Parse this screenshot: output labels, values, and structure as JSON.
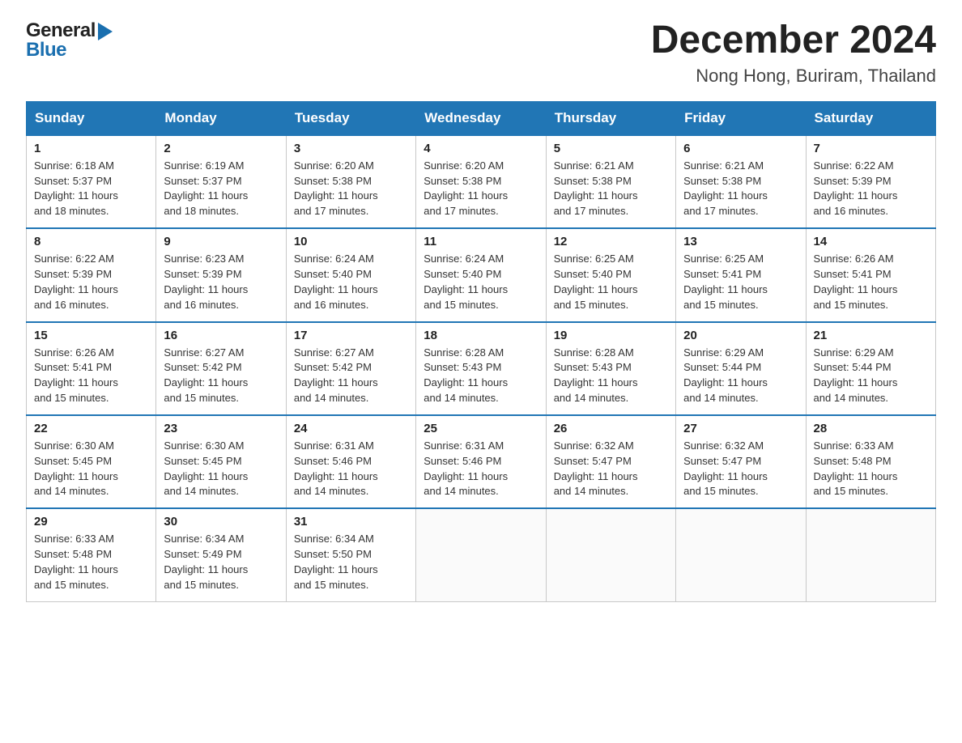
{
  "header": {
    "logo_general": "General",
    "logo_blue": "Blue",
    "month_title": "December 2024",
    "location": "Nong Hong, Buriram, Thailand"
  },
  "weekdays": [
    "Sunday",
    "Monday",
    "Tuesday",
    "Wednesday",
    "Thursday",
    "Friday",
    "Saturday"
  ],
  "weeks": [
    [
      {
        "day": "1",
        "info": "Sunrise: 6:18 AM\nSunset: 5:37 PM\nDaylight: 11 hours\nand 18 minutes."
      },
      {
        "day": "2",
        "info": "Sunrise: 6:19 AM\nSunset: 5:37 PM\nDaylight: 11 hours\nand 18 minutes."
      },
      {
        "day": "3",
        "info": "Sunrise: 6:20 AM\nSunset: 5:38 PM\nDaylight: 11 hours\nand 17 minutes."
      },
      {
        "day": "4",
        "info": "Sunrise: 6:20 AM\nSunset: 5:38 PM\nDaylight: 11 hours\nand 17 minutes."
      },
      {
        "day": "5",
        "info": "Sunrise: 6:21 AM\nSunset: 5:38 PM\nDaylight: 11 hours\nand 17 minutes."
      },
      {
        "day": "6",
        "info": "Sunrise: 6:21 AM\nSunset: 5:38 PM\nDaylight: 11 hours\nand 17 minutes."
      },
      {
        "day": "7",
        "info": "Sunrise: 6:22 AM\nSunset: 5:39 PM\nDaylight: 11 hours\nand 16 minutes."
      }
    ],
    [
      {
        "day": "8",
        "info": "Sunrise: 6:22 AM\nSunset: 5:39 PM\nDaylight: 11 hours\nand 16 minutes."
      },
      {
        "day": "9",
        "info": "Sunrise: 6:23 AM\nSunset: 5:39 PM\nDaylight: 11 hours\nand 16 minutes."
      },
      {
        "day": "10",
        "info": "Sunrise: 6:24 AM\nSunset: 5:40 PM\nDaylight: 11 hours\nand 16 minutes."
      },
      {
        "day": "11",
        "info": "Sunrise: 6:24 AM\nSunset: 5:40 PM\nDaylight: 11 hours\nand 15 minutes."
      },
      {
        "day": "12",
        "info": "Sunrise: 6:25 AM\nSunset: 5:40 PM\nDaylight: 11 hours\nand 15 minutes."
      },
      {
        "day": "13",
        "info": "Sunrise: 6:25 AM\nSunset: 5:41 PM\nDaylight: 11 hours\nand 15 minutes."
      },
      {
        "day": "14",
        "info": "Sunrise: 6:26 AM\nSunset: 5:41 PM\nDaylight: 11 hours\nand 15 minutes."
      }
    ],
    [
      {
        "day": "15",
        "info": "Sunrise: 6:26 AM\nSunset: 5:41 PM\nDaylight: 11 hours\nand 15 minutes."
      },
      {
        "day": "16",
        "info": "Sunrise: 6:27 AM\nSunset: 5:42 PM\nDaylight: 11 hours\nand 15 minutes."
      },
      {
        "day": "17",
        "info": "Sunrise: 6:27 AM\nSunset: 5:42 PM\nDaylight: 11 hours\nand 14 minutes."
      },
      {
        "day": "18",
        "info": "Sunrise: 6:28 AM\nSunset: 5:43 PM\nDaylight: 11 hours\nand 14 minutes."
      },
      {
        "day": "19",
        "info": "Sunrise: 6:28 AM\nSunset: 5:43 PM\nDaylight: 11 hours\nand 14 minutes."
      },
      {
        "day": "20",
        "info": "Sunrise: 6:29 AM\nSunset: 5:44 PM\nDaylight: 11 hours\nand 14 minutes."
      },
      {
        "day": "21",
        "info": "Sunrise: 6:29 AM\nSunset: 5:44 PM\nDaylight: 11 hours\nand 14 minutes."
      }
    ],
    [
      {
        "day": "22",
        "info": "Sunrise: 6:30 AM\nSunset: 5:45 PM\nDaylight: 11 hours\nand 14 minutes."
      },
      {
        "day": "23",
        "info": "Sunrise: 6:30 AM\nSunset: 5:45 PM\nDaylight: 11 hours\nand 14 minutes."
      },
      {
        "day": "24",
        "info": "Sunrise: 6:31 AM\nSunset: 5:46 PM\nDaylight: 11 hours\nand 14 minutes."
      },
      {
        "day": "25",
        "info": "Sunrise: 6:31 AM\nSunset: 5:46 PM\nDaylight: 11 hours\nand 14 minutes."
      },
      {
        "day": "26",
        "info": "Sunrise: 6:32 AM\nSunset: 5:47 PM\nDaylight: 11 hours\nand 14 minutes."
      },
      {
        "day": "27",
        "info": "Sunrise: 6:32 AM\nSunset: 5:47 PM\nDaylight: 11 hours\nand 15 minutes."
      },
      {
        "day": "28",
        "info": "Sunrise: 6:33 AM\nSunset: 5:48 PM\nDaylight: 11 hours\nand 15 minutes."
      }
    ],
    [
      {
        "day": "29",
        "info": "Sunrise: 6:33 AM\nSunset: 5:48 PM\nDaylight: 11 hours\nand 15 minutes."
      },
      {
        "day": "30",
        "info": "Sunrise: 6:34 AM\nSunset: 5:49 PM\nDaylight: 11 hours\nand 15 minutes."
      },
      {
        "day": "31",
        "info": "Sunrise: 6:34 AM\nSunset: 5:50 PM\nDaylight: 11 hours\nand 15 minutes."
      },
      {
        "day": "",
        "info": ""
      },
      {
        "day": "",
        "info": ""
      },
      {
        "day": "",
        "info": ""
      },
      {
        "day": "",
        "info": ""
      }
    ]
  ]
}
